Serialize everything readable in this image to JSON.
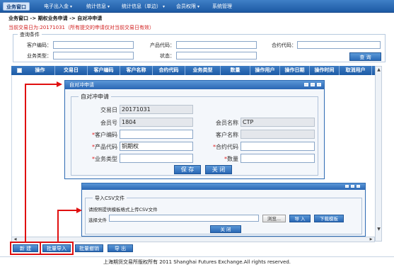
{
  "menubar": {
    "items": [
      {
        "label": "业务窗口",
        "active": true
      },
      {
        "label": "电子出入金",
        "caret": "▾"
      },
      {
        "label": "统计信息",
        "caret": "▾"
      },
      {
        "label": "统计信息（单边）",
        "caret": "▾"
      },
      {
        "label": "会员权限",
        "caret": "▾"
      },
      {
        "label": "系统管理"
      }
    ]
  },
  "breadcrumb": "业务窗口 -> 期权业务申请 -> 自对冲申请",
  "tradedate_note": "当前交易日为:20171031（所有提交的申请仅对当前交易日有效）",
  "query": {
    "legend": "查询条件",
    "customer_code_label": "客户编码：",
    "product_code_label": "产品代码：",
    "contract_code_label": "合约代码：",
    "business_type_label": "业务类型：",
    "status_label": "状态：",
    "query_button": "查 询"
  },
  "grid": {
    "columns": [
      "操作",
      "交易日",
      "客户编码",
      "客户名称",
      "合约代码",
      "业务类型",
      "数量",
      "操作用户",
      "操作日期",
      "操作时间",
      "取消用户"
    ]
  },
  "hedge_dialog": {
    "title": "自对冲申请",
    "legend": "自对冲申请",
    "trade_date_label": "交易日",
    "trade_date_value": "20171031",
    "member_no_label": "会员号",
    "member_no_value": "1804",
    "member_name_label": "会员名称",
    "member_name_value": "CTP",
    "customer_code_label": "客户编码",
    "customer_name_label": "客户名称",
    "product_code_label": "产品代码",
    "product_code_value": "铜期权",
    "contract_code_label": "合约代码",
    "business_type_label": "业务类型",
    "quantity_label": "数量",
    "required_mark": "*",
    "save_button": "保 存",
    "close_button": "关 闭"
  },
  "csv_dialog": {
    "legend": "导入CSV文件",
    "instruction": "请按照提供模板格式上传CSV文件",
    "file_label": "选择文件",
    "browse_button": "浏览...",
    "import_button": "导 入",
    "download_button": "下载模板",
    "close_button": "关 闭"
  },
  "bottom_buttons": {
    "new": "新 建",
    "batch_import": "批量导入",
    "batch_cancel": "批量撤销",
    "export": "导 出"
  },
  "footer": "上海期货交易所版权所有 2011 Shanghai Futures Exchange.All rights reserved.",
  "colors": {
    "accent": "#2a66b3",
    "annotation": "#e01010",
    "notice": "#d21f1f"
  }
}
